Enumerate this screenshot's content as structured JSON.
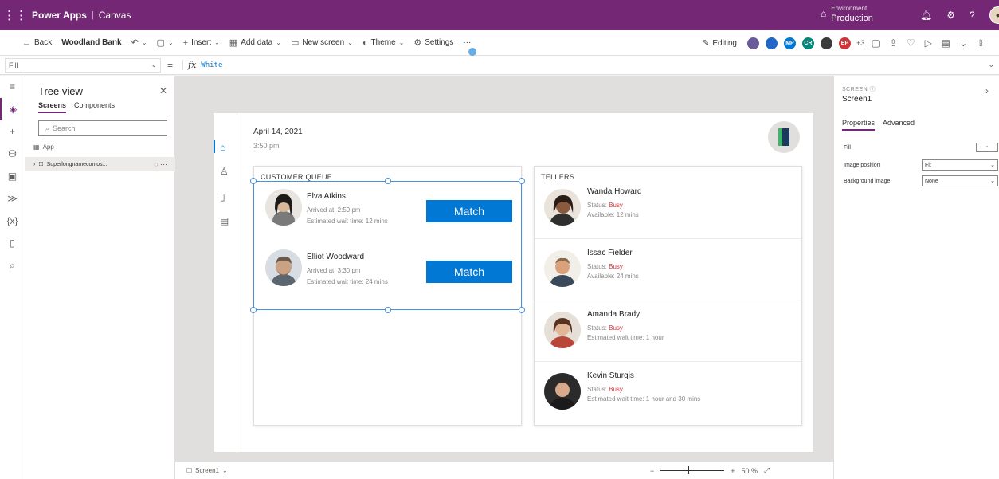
{
  "topbar": {
    "waffle_icon": "⋮⋮⋮",
    "app_name": "Power Apps",
    "app_type": "Canvas",
    "environment_label": "Environment",
    "environment_name": "Production",
    "accent": "#742774"
  },
  "commandbar": {
    "back": "Back",
    "app_title": "Woodland Bank",
    "insert": "Insert",
    "add_data": "Add data",
    "new_screen": "New screen",
    "theme": "Theme",
    "settings": "Settings",
    "more": "···",
    "editing": "Editing",
    "presence_overflow": "+3",
    "presence": [
      {
        "initials": "",
        "color": "#6b5b9a"
      },
      {
        "initials": "",
        "color": "#2266c8"
      },
      {
        "initials": "MP",
        "color": "#0078d4"
      },
      {
        "initials": "CR",
        "color": "#00897b"
      },
      {
        "initials": "",
        "color": "#3b3b3b"
      },
      {
        "initials": "EP",
        "color": "#d13438"
      }
    ]
  },
  "formulabar": {
    "property": "Fill",
    "fx": "fx",
    "formula": "White"
  },
  "tree": {
    "title": "Tree view",
    "tab_screens": "Screens",
    "tab_components": "Components",
    "search_placeholder": "Search",
    "app_node": "App",
    "screen_node": "Superlongnamecontos..."
  },
  "app_screen": {
    "date": "April 14, 2021",
    "time": "3:50 pm",
    "queue_title": "CUSTOMER QUEUE",
    "tellers_title": "TELLERS",
    "match_label": "Match",
    "queue": [
      {
        "name": "Elva Atkins",
        "line1": "Arrived at: 2:59 pm",
        "line2": "Estimated wait time: 12 mins"
      },
      {
        "name": "Elliot Woodward",
        "line1": "Arrived at: 3:30 pm",
        "line2": "Estimated wait time: 24 mins"
      }
    ],
    "tellers": [
      {
        "name": "Wanda Howard",
        "status_label": "Status:",
        "status": "Busy",
        "line2": "Available: 12 mins"
      },
      {
        "name": "Issac Fielder",
        "status_label": "Status:",
        "status": "Busy",
        "line2": "Available: 24 mins"
      },
      {
        "name": "Amanda Brady",
        "status_label": "Status:",
        "status": "Busy",
        "line2": "Estimated wait time: 1 hour"
      },
      {
        "name": "Kevin Sturgis",
        "status_label": "Status:",
        "status": "Busy",
        "line2": "Estimated wait time: 1 hour and 30 mins"
      }
    ]
  },
  "statusbar": {
    "screen": "Screen1",
    "zoom": "50 %"
  },
  "props": {
    "kind": "SCREEN",
    "name": "Screen1",
    "tab_properties": "Properties",
    "tab_advanced": "Advanced",
    "fill_label": "Fill",
    "image_position_label": "Image position",
    "image_position_value": "Fit",
    "background_image_label": "Background image",
    "background_image_value": "None"
  }
}
